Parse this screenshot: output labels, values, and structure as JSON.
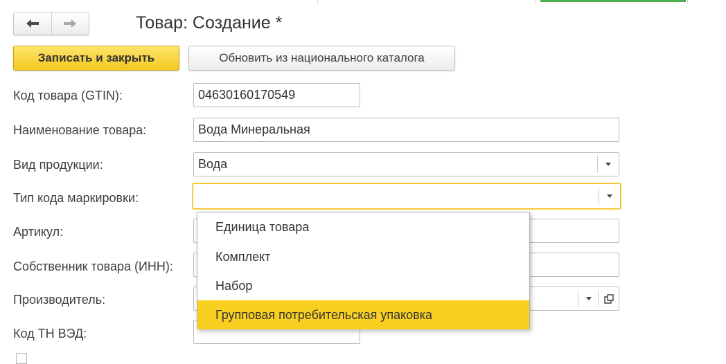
{
  "window": {
    "title": "Товар: Создание *"
  },
  "nav": {
    "back_icon": "arrow-left-icon",
    "forward_icon": "arrow-right-icon"
  },
  "toolbar": {
    "save_close_label": "Записать и закрыть",
    "update_catalog_label": "Обновить из национального каталога"
  },
  "form": {
    "gtin": {
      "label": "Код товара (GTIN):",
      "value": "04630160170549"
    },
    "name": {
      "label": "Наименование товара:",
      "value": "Вода Минеральная"
    },
    "product_type": {
      "label": "Вид продукции:",
      "value": "Вода"
    },
    "marking_code_type": {
      "label": "Тип кода маркировки:",
      "value": ""
    },
    "article": {
      "label": "Артикул:",
      "value": ""
    },
    "owner": {
      "label": "Собственник товара (ИНН):",
      "value": ""
    },
    "manufacturer": {
      "label": "Производитель:",
      "value": ""
    },
    "tn_ved": {
      "label": "Код ТН ВЭД:",
      "value": ""
    }
  },
  "dropdown": {
    "options": [
      {
        "label": "Единица товара",
        "selected": false
      },
      {
        "label": "Комплект",
        "selected": false
      },
      {
        "label": "Набор",
        "selected": false
      },
      {
        "label": "Групповая потребительская упаковка",
        "selected": true
      }
    ]
  },
  "colors": {
    "accent_yellow": "#f3c81f",
    "selection_yellow": "#f9cf22",
    "focus_border": "#f2c21b"
  }
}
